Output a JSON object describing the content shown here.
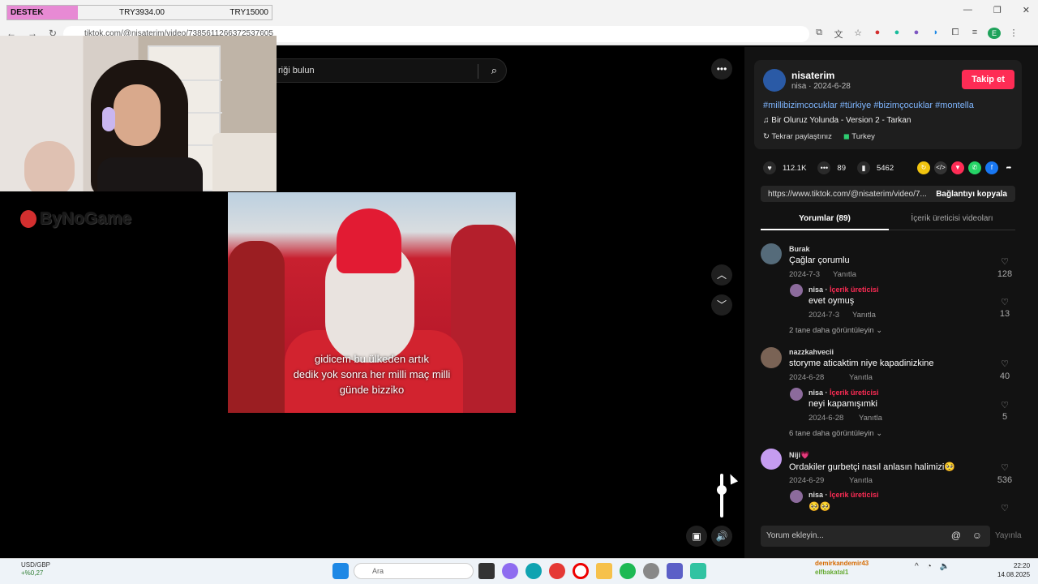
{
  "overlay": {
    "donation": {
      "label": "DESTEK",
      "current": "TRY3934.00",
      "goal": "TRY15000"
    },
    "sponsor": "ByNoGame"
  },
  "browser": {
    "url": "tiktok.com/@nisaterim/video/7385611266372537605",
    "window_controls": [
      "—",
      "❐",
      "✕"
    ]
  },
  "tiktok": {
    "search_placeholder": "riği bulun",
    "video": {
      "caption_lines": [
        "gidicem bu ülkeden artık",
        "dedik yok sonra her milli maç milli",
        "günde bizziko"
      ]
    },
    "author": {
      "username": "nisaterim",
      "meta": "nisa · 2024-6-28",
      "follow_label": "Takip et"
    },
    "hashtags": "#millibizimcocuklar #türkiye #bizimçocuklar #montella",
    "music": "Bir Oluruz Yolunda - Version 2 - Tarkan",
    "repost_label": "Tekrar paylaştınız",
    "location": "Turkey",
    "stats": {
      "likes": "112.1K",
      "comments": "89",
      "saves": "5462"
    },
    "share_link": "https://www.tiktok.com/@nisaterim/video/7...",
    "copy_link_label": "Bağlantıyı kopyala",
    "tabs": {
      "comments": "Yorumlar (89)",
      "creator_videos": "İçerik üreticisi videoları"
    },
    "comments": [
      {
        "user": "Burak",
        "text": "Çağlar çorumlu",
        "date": "2024-7-3",
        "reply_label": "Yanıtla",
        "likes": "128",
        "reply": {
          "user": "nisa",
          "badge": "İçerik üreticisi",
          "text": "evet oymuş",
          "date": "2024-7-3",
          "reply_label": "Yanıtla",
          "likes": "13"
        },
        "more": "2 tane daha görüntüleyin"
      },
      {
        "user": "nazzkahvecii",
        "text": "storyme aticaktim niye kapadinizkine",
        "date": "2024-6-28",
        "reply_label": "Yanıtla",
        "likes": "40",
        "reply": {
          "user": "nisa",
          "badge": "İçerik üreticisi",
          "text": "neyi kapamışımki",
          "date": "2024-6-28",
          "reply_label": "Yanıtla",
          "likes": "5"
        },
        "more": "6 tane daha görüntüleyin"
      },
      {
        "user": "Niji💗",
        "text": "Ordakiler gurbetçi nasıl anlasın halimizi🥺",
        "date": "2024-6-29",
        "reply_label": "Yanıtla",
        "likes": "536",
        "reply": {
          "user": "nisa",
          "badge": "İçerik üreticisi",
          "text": "🥺🥺"
        }
      }
    ],
    "comment_placeholder": "Yorum ekleyin...",
    "post_label": "Yayınla"
  },
  "taskbar": {
    "ticker_pair": "USD/GBP",
    "ticker_change": "+%0,27",
    "search_placeholder": "Ara",
    "time": "22:20",
    "date": "14.08.2025",
    "chat_user1": "demirkandemir43",
    "chat_user2": "elfbakatal1"
  },
  "colors": {
    "accent": "#fe2c55",
    "hashtag": "#7fb6ff",
    "donation_label": "#e78ad4"
  }
}
